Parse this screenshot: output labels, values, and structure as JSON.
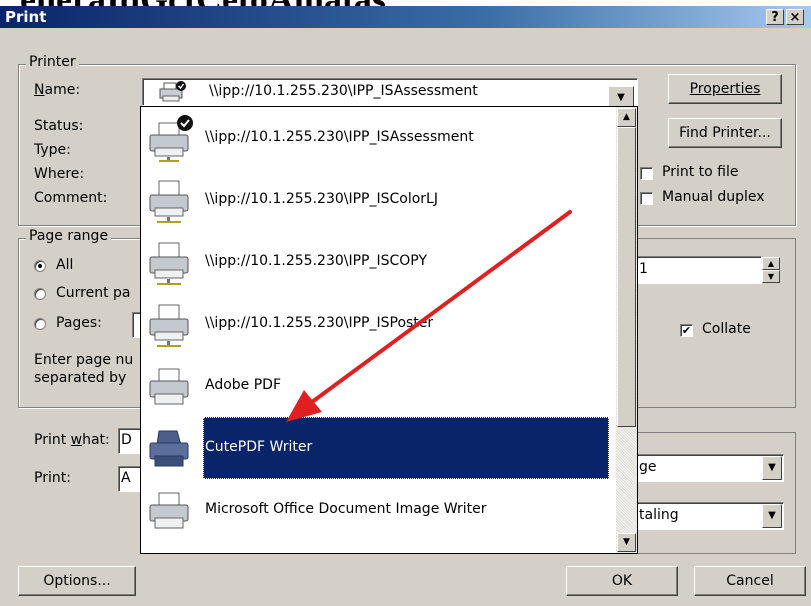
{
  "background_text": "eneraIdGctCetoAinatas",
  "dialog": {
    "title": "Print",
    "help_button": "?",
    "close_button": "×"
  },
  "printer_group": {
    "label": "Printer",
    "name_label": "Name:",
    "name_value": "\\\\ipp://10.1.255.230\\IPP_ISAssessment",
    "status_label": "Status:",
    "type_label": "Type:",
    "where_label": "Where:",
    "comment_label": "Comment:",
    "properties_button": "Properties",
    "find_printer_button": "Find Printer...",
    "print_to_file_label": "Print to file",
    "print_to_file_checked": false,
    "manual_duplex_label": "Manual duplex",
    "manual_duplex_checked": false
  },
  "page_range_group": {
    "label": "Page range",
    "all_label": "All",
    "current_page_label": "Current pa",
    "pages_label": "Pages:",
    "selected": "All",
    "hint_line1": "Enter page nu",
    "hint_line2": "separated by",
    "copies_value": "1",
    "collate_label": "Collate",
    "collate_checked": true
  },
  "print_options": {
    "print_what_label": "Print what:",
    "print_what_value": "D",
    "print_label": "Print:",
    "print_value": "A",
    "zoom_pages_value": "ge",
    "zoom_scale_value": "taling"
  },
  "footer": {
    "options_button": "Options...",
    "ok_button": "OK",
    "cancel_button": "Cancel"
  },
  "printer_list": {
    "items": [
      {
        "label": "\\\\ipp://10.1.255.230\\IPP_ISAssessment",
        "icon": "network-printer-default-icon"
      },
      {
        "label": "\\\\ipp://10.1.255.230\\IPP_ISColorLJ",
        "icon": "network-printer-icon"
      },
      {
        "label": "\\\\ipp://10.1.255.230\\IPP_ISCOPY",
        "icon": "network-printer-icon"
      },
      {
        "label": "\\\\ipp://10.1.255.230\\IPP_ISPoster",
        "icon": "network-printer-icon"
      },
      {
        "label": "Adobe PDF",
        "icon": "printer-icon"
      },
      {
        "label": "CutePDF Writer",
        "icon": "printer-icon",
        "selected": true
      },
      {
        "label": "Microsoft Office Document Image Writer",
        "icon": "printer-icon"
      }
    ]
  },
  "colors": {
    "selection": "#0a246a",
    "annotation_arrow": "#e02020",
    "dialog_face": "#d4d0c8"
  }
}
